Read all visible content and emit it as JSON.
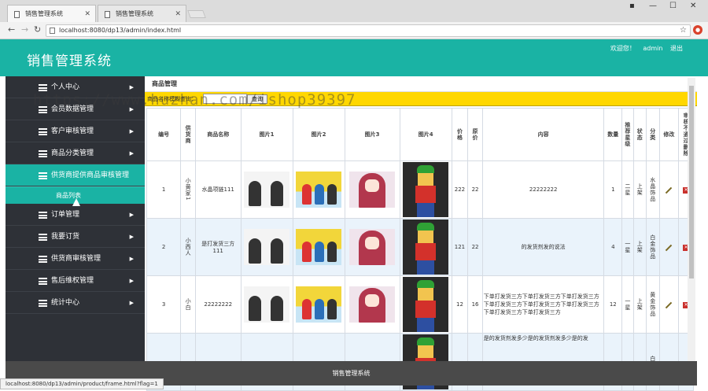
{
  "browser": {
    "tabs": [
      {
        "label": "销售管理系统"
      },
      {
        "label": "销售管理系统"
      }
    ],
    "url": "localhost:8080/dp13/admin/index.html",
    "status_url": "localhost:8080/dp13/admin/product/frame.html?flag=1"
  },
  "header": {
    "title": "销售管理系统",
    "welcome": "欢迎您！",
    "user": "admin",
    "logout": "退出"
  },
  "sidebar": {
    "items": [
      {
        "label": "个人中心"
      },
      {
        "label": "会员数据管理"
      },
      {
        "label": "客户审核管理"
      },
      {
        "label": "商品分类管理"
      },
      {
        "label": "供货商提供商品审核管理"
      },
      {
        "label": "订单管理"
      },
      {
        "label": "我要订货"
      },
      {
        "label": "供货商审核管理"
      },
      {
        "label": "售后维权管理"
      },
      {
        "label": "统计中心"
      }
    ],
    "submenu_label": "商品列表"
  },
  "main": {
    "title": "商品管理",
    "search_label": "商品名称模糊查询：",
    "search_button": "查询",
    "columns": [
      "编号",
      "供货商",
      "商品名称",
      "图片1",
      "图片2",
      "图片3",
      "图片4",
      "价格",
      "原价",
      "内容",
      "数量",
      "推荐星级",
      "状态",
      "分类",
      "修改",
      "审核不通过删除"
    ],
    "rows": [
      {
        "id": "1",
        "supplier": "小黄家1",
        "name": "水晶项链111",
        "price": "222",
        "orig": "22",
        "content": "22222222",
        "qty": "1",
        "stars": "二星",
        "status": "上架",
        "category": "水晶饰品"
      },
      {
        "id": "2",
        "supplier": "小西人",
        "name": "是打发货三方111",
        "price": "121",
        "orig": "22",
        "content": "的发货剂发的说法",
        "qty": "4",
        "stars": "一星",
        "status": "上架",
        "category": "白金饰品"
      },
      {
        "id": "3",
        "supplier": "小白",
        "name": "22222222",
        "price": "12",
        "orig": "16",
        "content": "下单打发货三方下单打发货三方下单打发货三方下单打发货三方下单打发货三方下单打发货三方下单打发货三方下单打发货三方",
        "qty": "12",
        "stars": "一星",
        "status": "上架",
        "category": "黄金饰品"
      },
      {
        "id": "",
        "supplier": "",
        "name": "",
        "price": "",
        "orig": "",
        "content": "是的发货剂发多少是的发货剂发多少是的发",
        "qty": "",
        "stars": "",
        "status": "",
        "category": "白金"
      }
    ]
  },
  "watermark": "https://www.huzhan.com/ishop39397",
  "footer": {
    "text": "销售管理系统"
  }
}
